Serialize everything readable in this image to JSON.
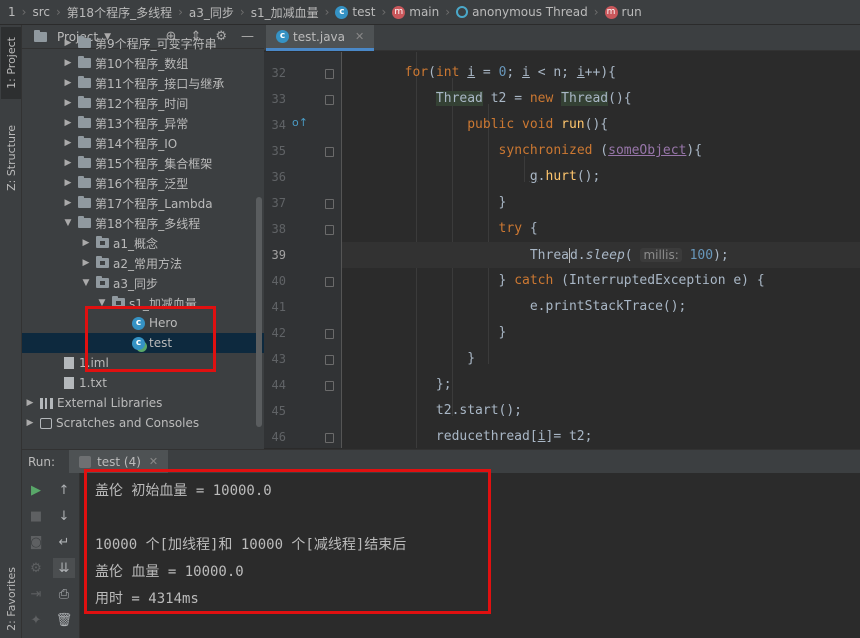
{
  "breadcrumb": {
    "items": [
      {
        "label": "1",
        "icon": ""
      },
      {
        "label": "src",
        "icon": ""
      },
      {
        "label": "第18个程序_多线程",
        "icon": ""
      },
      {
        "label": "a3_同步",
        "icon": ""
      },
      {
        "label": "s1_加减血量",
        "icon": ""
      },
      {
        "label": "test",
        "icon": "class-icon"
      },
      {
        "label": "main",
        "icon": "method-icon"
      },
      {
        "label": "anonymous Thread",
        "icon": "anonymous-class-icon"
      },
      {
        "label": "run",
        "icon": "method-icon"
      }
    ]
  },
  "left_strip": {
    "project_tab": "1: Project",
    "structure_tab": "Z: Structure",
    "favorites_tab": "2: Favorites"
  },
  "project_panel": {
    "title": "Project",
    "tree": [
      {
        "label": "第9个程序_可变字符串",
        "type": "folder",
        "expanded": false
      },
      {
        "label": "第10个程序_数组",
        "type": "folder",
        "expanded": false
      },
      {
        "label": "第11个程序_接口与继承",
        "type": "folder",
        "expanded": false
      },
      {
        "label": "第12个程序_时间",
        "type": "folder",
        "expanded": false
      },
      {
        "label": "第13个程序_异常",
        "type": "folder",
        "expanded": false
      },
      {
        "label": "第14个程序_IO",
        "type": "folder",
        "expanded": false
      },
      {
        "label": "第15个程序_集合框架",
        "type": "folder",
        "expanded": false
      },
      {
        "label": "第16个程序_泛型",
        "type": "folder",
        "expanded": false
      },
      {
        "label": "第17个程序_Lambda",
        "type": "folder",
        "expanded": false
      },
      {
        "label": "第18个程序_多线程",
        "type": "folder",
        "expanded": true
      },
      {
        "label": "a1_概念",
        "type": "package",
        "expanded": false
      },
      {
        "label": "a2_常用方法",
        "type": "package",
        "expanded": false
      },
      {
        "label": "a3_同步",
        "type": "package",
        "expanded": true
      },
      {
        "label": "s1_加减血量",
        "type": "package",
        "expanded": true
      },
      {
        "label": "Hero",
        "type": "class"
      },
      {
        "label": "test",
        "type": "class-runnable",
        "selected": true
      },
      {
        "label": "1.iml",
        "type": "file"
      },
      {
        "label": "1.txt",
        "type": "file"
      },
      {
        "label": "External Libraries",
        "type": "libraries"
      },
      {
        "label": "Scratches and Consoles",
        "type": "scratches"
      }
    ]
  },
  "editor": {
    "tab_label": "test.java",
    "line_numbers": [
      "32",
      "33",
      "34",
      "35",
      "36",
      "37",
      "38",
      "39",
      "40",
      "41",
      "42",
      "43",
      "44",
      "45",
      "46"
    ],
    "current_line": "39",
    "param_hint": "millis:"
  },
  "run_panel": {
    "label": "Run:",
    "tab_label": "test (4)",
    "output": [
      "盖伦 初始血量 = 10000.0",
      "",
      "10000 个[加线程]和 10000 个[减线程]结束后",
      "盖伦 血量 = 10000.0",
      "用时 = 4314ms"
    ]
  },
  "colors": {
    "annotation_red": "#e01010",
    "keyword": "#cc7832",
    "number": "#6897bb",
    "method": "#ffc66d",
    "field": "#9876aa",
    "accent_tab": "#4a88c7"
  }
}
